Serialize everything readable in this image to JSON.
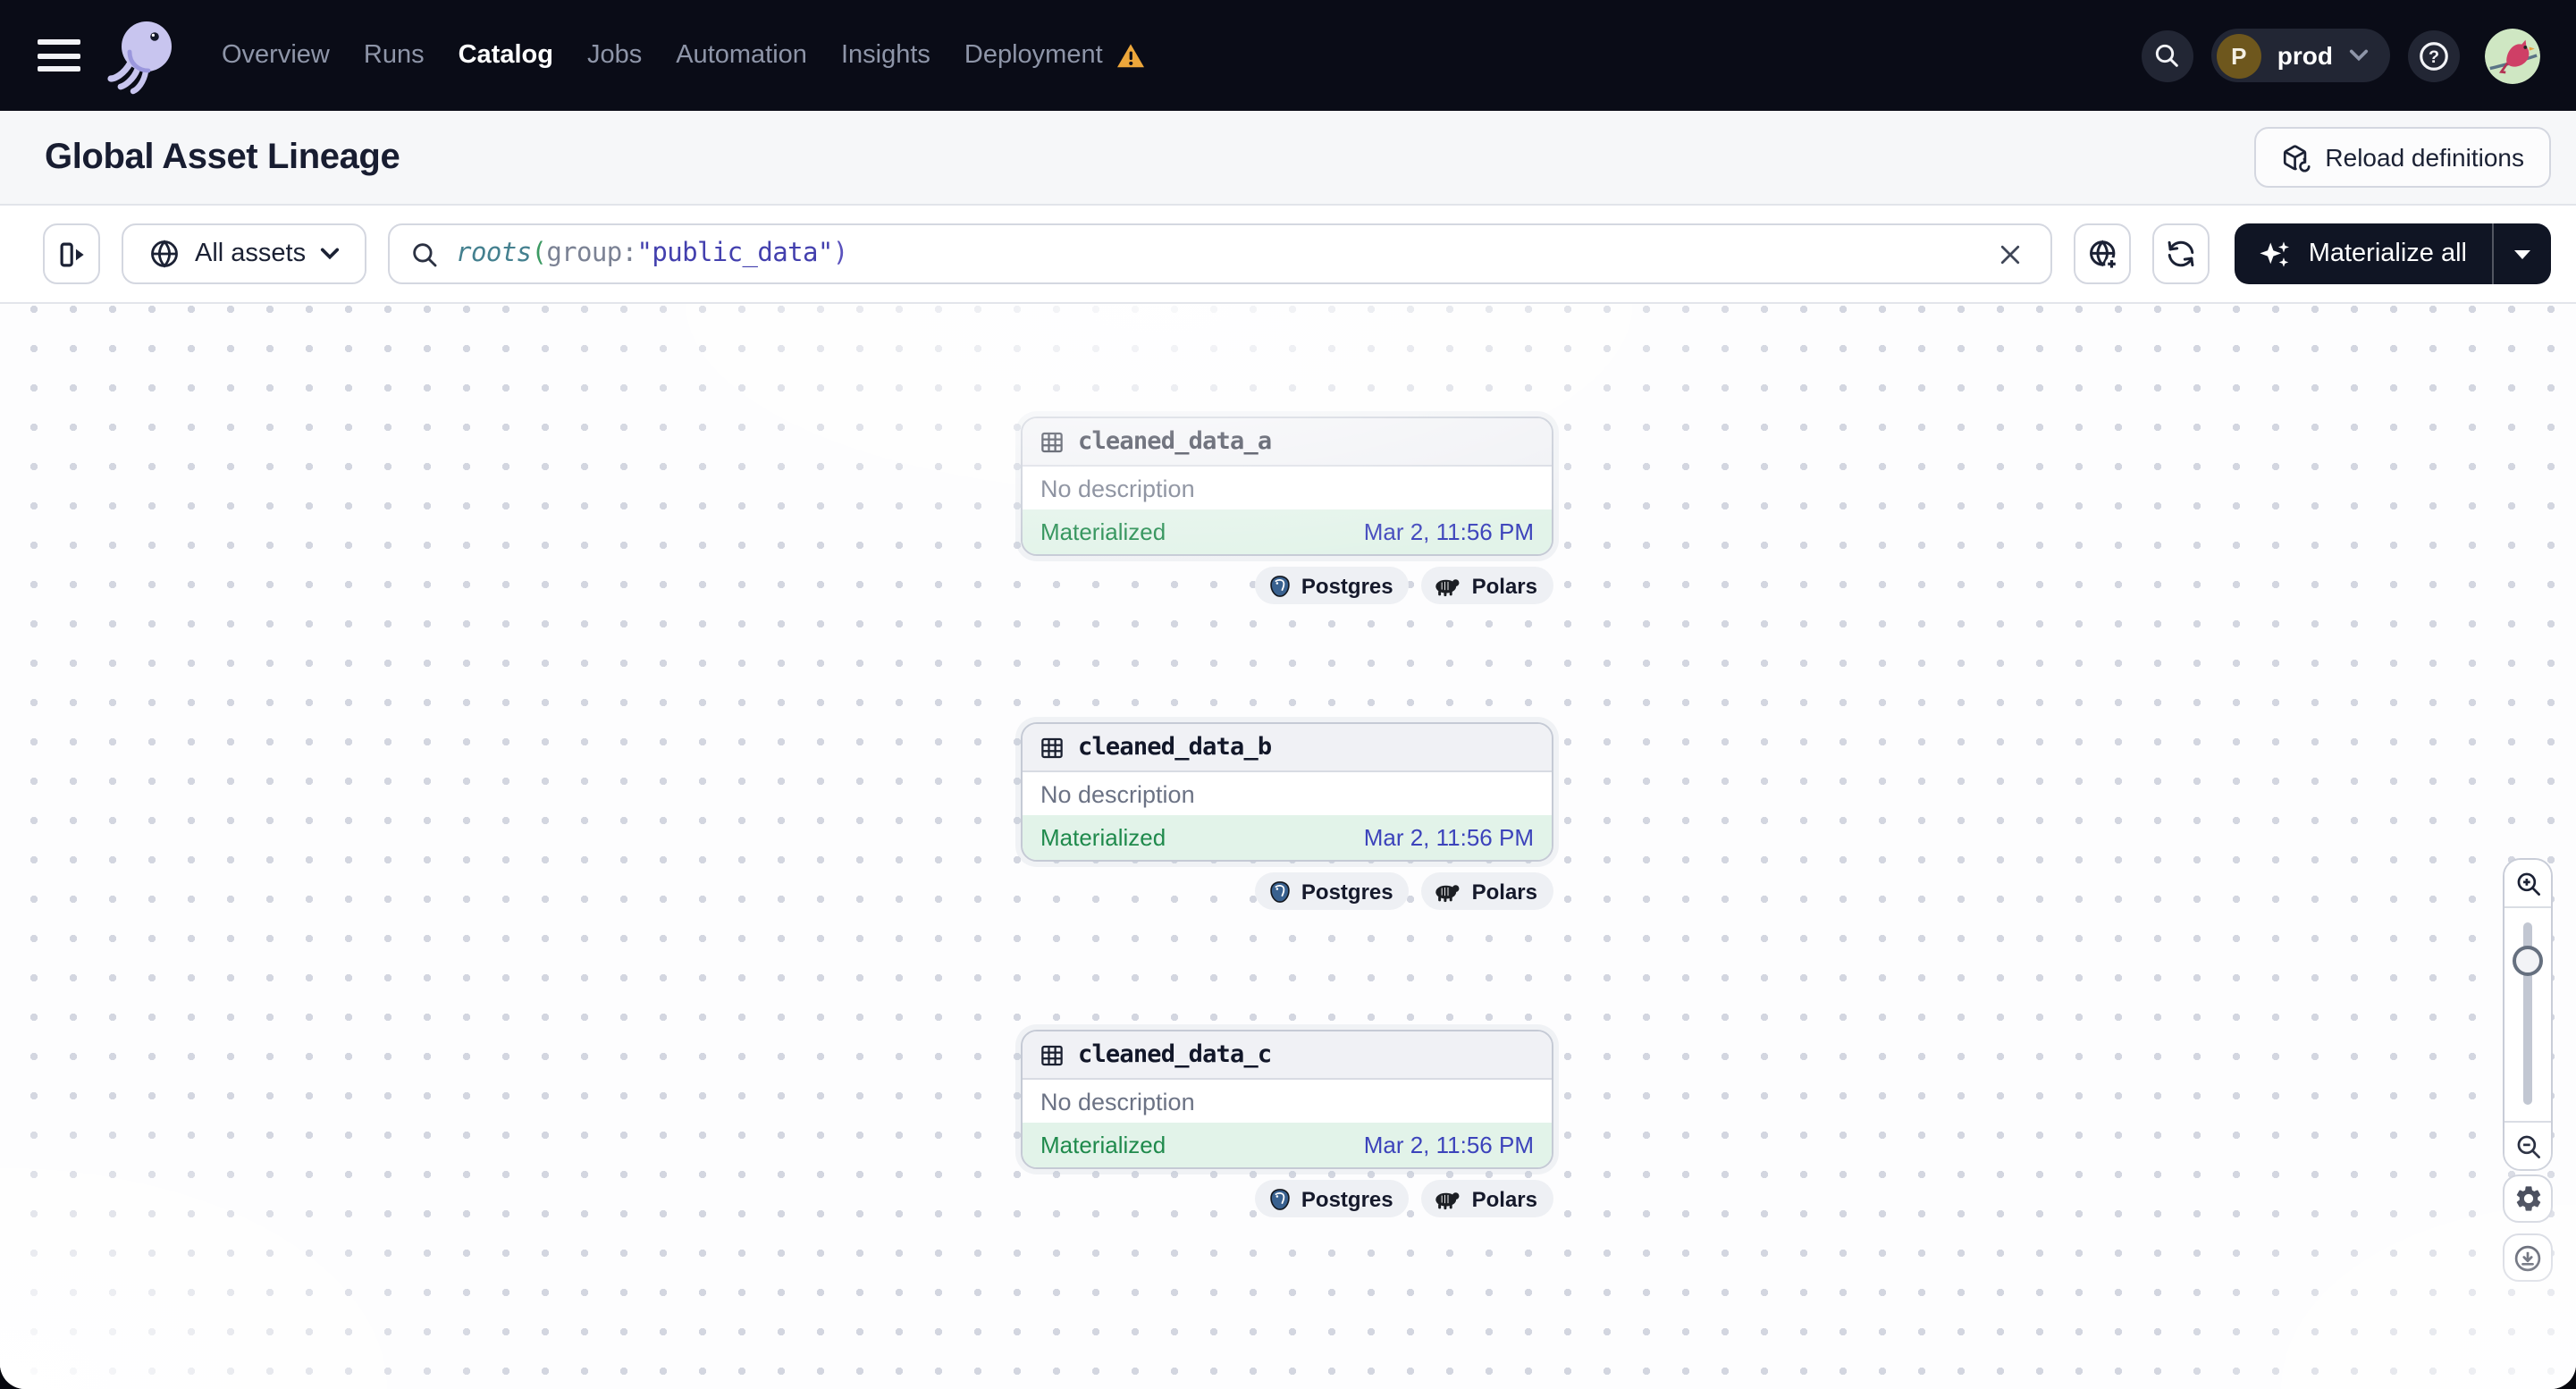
{
  "navbar": {
    "items": [
      {
        "label": "Overview"
      },
      {
        "label": "Runs"
      },
      {
        "label": "Catalog"
      },
      {
        "label": "Jobs"
      },
      {
        "label": "Automation"
      },
      {
        "label": "Insights"
      },
      {
        "label": "Deployment"
      }
    ],
    "active_item": "Catalog",
    "deployment_has_warning": true,
    "environment": {
      "initial": "P",
      "name": "prod"
    }
  },
  "page_header": {
    "title": "Global Asset Lineage",
    "reload_button": "Reload definitions"
  },
  "toolbar": {
    "scope_button": "All assets",
    "search_query": {
      "function": "roots",
      "open_paren": "(",
      "argument_key": "group:",
      "argument_value": "\"public_data\"",
      "close_paren": ")"
    },
    "materialize_button": "Materialize all"
  },
  "graph": {
    "nodes": [
      {
        "name": "cleaned_data_a",
        "description": "No description",
        "status": "Materialized",
        "materialized_at": "Mar 2, 11:56 PM",
        "tags": [
          {
            "label": "Postgres"
          },
          {
            "label": "Polars"
          }
        ]
      },
      {
        "name": "cleaned_data_b",
        "description": "No description",
        "status": "Materialized",
        "materialized_at": "Mar 2, 11:56 PM",
        "tags": [
          {
            "label": "Postgres"
          },
          {
            "label": "Polars"
          }
        ]
      },
      {
        "name": "cleaned_data_c",
        "description": "No description",
        "status": "Materialized",
        "materialized_at": "Mar 2, 11:56 PM",
        "tags": [
          {
            "label": "Postgres"
          },
          {
            "label": "Polars"
          }
        ]
      }
    ]
  },
  "icons": {
    "menu": "hamburger",
    "logo": "dagster-octopus",
    "warning": "triangle-exclamation",
    "search": "magnifier",
    "help": "question-mark-circle",
    "reload": "box-refresh",
    "panel_toggle": "panel-expand-right",
    "scope": "globe",
    "clear": "x",
    "new_catalog_view": "globe-plus",
    "refresh": "circular-arrows",
    "materialize": "sparkles",
    "asset": "table-grid",
    "zoom_in": "magnifier-plus",
    "zoom_out": "magnifier-minus",
    "settings": "gear",
    "download": "arrow-down-circle",
    "postgres": "elephant-logo",
    "polars": "bear-logo"
  },
  "colors": {
    "navbar_bg": "#0a0c17",
    "nav_text": "#8e95a8",
    "nav_active": "#ffffff",
    "warning_orange": "#eda73b",
    "header_bg": "#f6f7f9",
    "materialize_bg": "#101524",
    "status_green": "#1f8a4c",
    "status_bg": "#e2f3e9",
    "timestamp_blue": "#3c43bb",
    "query_function": "#44808f",
    "query_string": "#4340ae",
    "postgres_blue": "#39618f",
    "env_avatar": "#6e571d"
  }
}
